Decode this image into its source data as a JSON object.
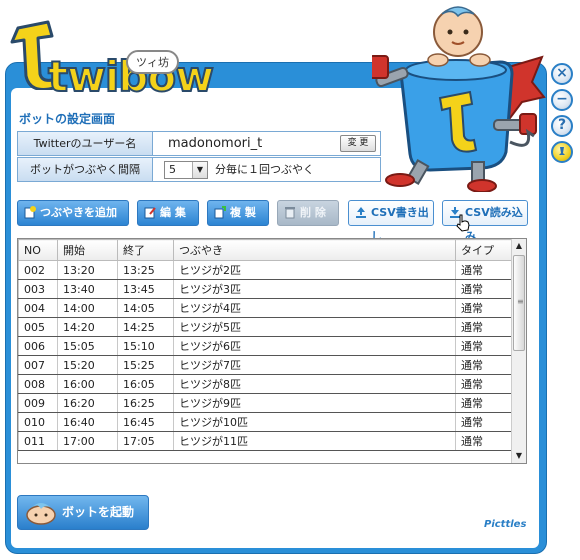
{
  "app": {
    "logo_text": "twibow",
    "logo_badge": "ツィ坊",
    "brand": "Picttles"
  },
  "settings": {
    "section_title": "ボットの設定画面",
    "twitter_user_label": "Twitterのユーザー名",
    "twitter_user_value": "madonomori_t",
    "change_button": "変 更",
    "interval_label": "ボットがつぶやく間隔",
    "interval_value": "5",
    "interval_suffix": "分毎に１回つぶやく"
  },
  "toolbar": {
    "add": "つぶやきを追加",
    "edit": "編 集",
    "copy": "複 製",
    "delete": "削 除",
    "csv_export": "CSV書き出し",
    "csv_import": "CSV読み込み"
  },
  "table": {
    "headers": [
      "NO",
      "開始",
      "終了",
      "つぶやき",
      "タイプ"
    ],
    "rows": [
      [
        "002",
        "13:20",
        "13:25",
        "ヒツジが2匹",
        "通常"
      ],
      [
        "003",
        "13:40",
        "13:45",
        "ヒツジが3匹",
        "通常"
      ],
      [
        "004",
        "14:00",
        "14:05",
        "ヒツジが4匹",
        "通常"
      ],
      [
        "005",
        "14:20",
        "14:25",
        "ヒツジが5匹",
        "通常"
      ],
      [
        "006",
        "15:05",
        "15:10",
        "ヒツジが6匹",
        "通常"
      ],
      [
        "007",
        "15:20",
        "15:25",
        "ヒツジが7匹",
        "通常"
      ],
      [
        "008",
        "16:00",
        "16:05",
        "ヒツジが8匹",
        "通常"
      ],
      [
        "009",
        "16:20",
        "16:25",
        "ヒツジが9匹",
        "通常"
      ],
      [
        "010",
        "16:40",
        "16:45",
        "ヒツジが10匹",
        "通常"
      ],
      [
        "011",
        "17:00",
        "17:05",
        "ヒツジが11匹",
        "通常"
      ]
    ]
  },
  "start_button": "ボットを起動",
  "icons": {
    "close": "close-icon",
    "minimize": "minimize-icon",
    "help": "help-icon",
    "pin": "pin-icon"
  },
  "colors": {
    "frame": "#2a8fd8",
    "accent": "#1f6fb8",
    "logo_yellow": "#f4d21a"
  }
}
